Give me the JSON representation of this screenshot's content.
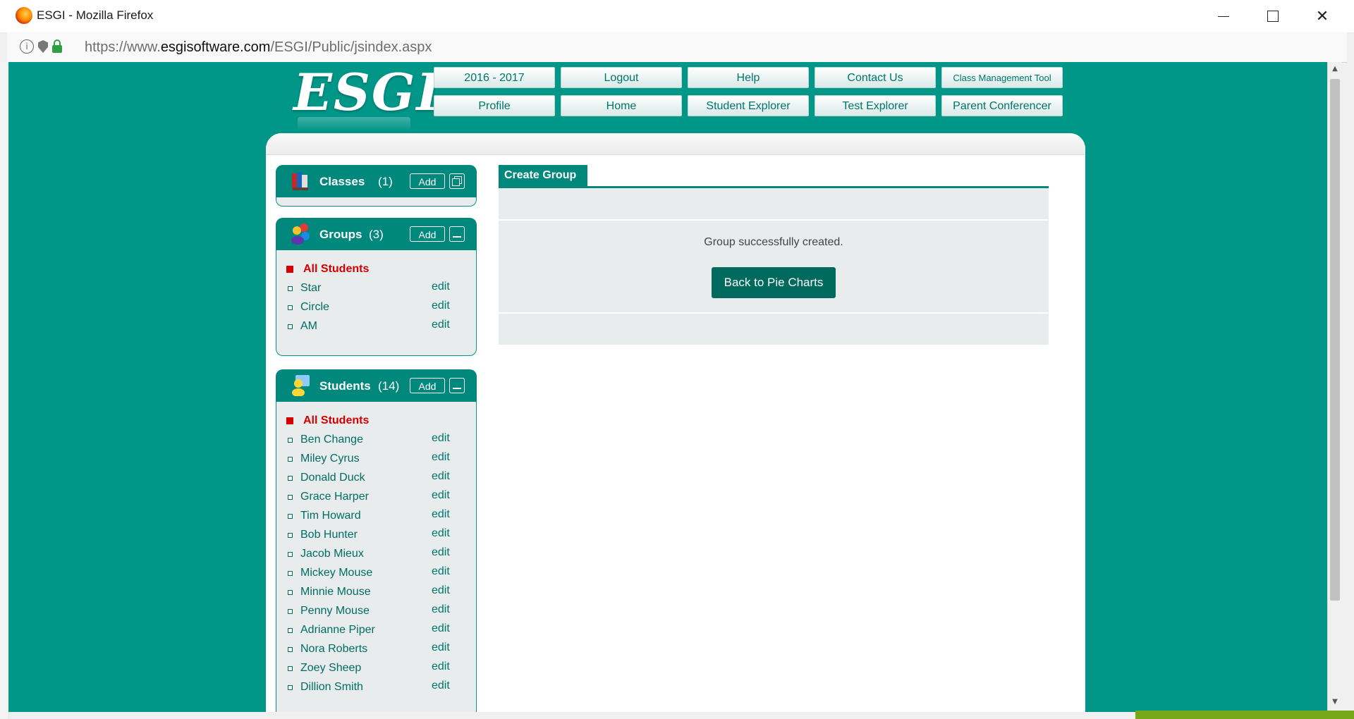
{
  "window": {
    "title": "ESGI - Mozilla Firefox"
  },
  "address": {
    "prefix": "https://www.",
    "domain": "esgisoftware.com",
    "path": "/ESGI/Public/jsindex.aspx"
  },
  "logo": {
    "text": "ESGI"
  },
  "nav": {
    "year": "2016 - 2017",
    "logout": "Logout",
    "help": "Help",
    "contact": "Contact Us",
    "class_mgmt": "Class Management Tool",
    "profile": "Profile",
    "home": "Home",
    "student_explorer": "Student Explorer",
    "test_explorer": "Test Explorer",
    "parent_conferencer": "Parent Conferencer"
  },
  "classes": {
    "title": "Classes",
    "count": "(1)",
    "add": "Add"
  },
  "groups": {
    "title": "Groups",
    "count": "(3)",
    "add": "Add",
    "all": "All Students",
    "items": [
      {
        "name": "Star",
        "edit": "edit"
      },
      {
        "name": "Circle",
        "edit": "edit"
      },
      {
        "name": "AM",
        "edit": "edit"
      }
    ]
  },
  "students": {
    "title": "Students",
    "count": "(14)",
    "add": "Add",
    "all": "All Students",
    "items": [
      {
        "name": "Ben Change",
        "edit": "edit"
      },
      {
        "name": "Miley Cyrus",
        "edit": "edit"
      },
      {
        "name": "Donald Duck",
        "edit": "edit"
      },
      {
        "name": "Grace Harper",
        "edit": "edit"
      },
      {
        "name": "Tim Howard",
        "edit": "edit"
      },
      {
        "name": "Bob Hunter",
        "edit": "edit"
      },
      {
        "name": "Jacob Mieux",
        "edit": "edit"
      },
      {
        "name": "Mickey Mouse",
        "edit": "edit"
      },
      {
        "name": "Minnie Mouse",
        "edit": "edit"
      },
      {
        "name": "Penny Mouse",
        "edit": "edit"
      },
      {
        "name": "Adrianne Piper",
        "edit": "edit"
      },
      {
        "name": "Nora Roberts",
        "edit": "edit"
      },
      {
        "name": "Zoey Sheep",
        "edit": "edit"
      },
      {
        "name": "Dillion Smith",
        "edit": "edit"
      }
    ]
  },
  "content": {
    "tab": "Create Group",
    "message": "Group successfully created.",
    "back_button": "Back to Pie Charts"
  },
  "colors": {
    "brand": "#009688",
    "header": "#00887c",
    "button": "#006a5f",
    "highlight": "#d40000"
  }
}
